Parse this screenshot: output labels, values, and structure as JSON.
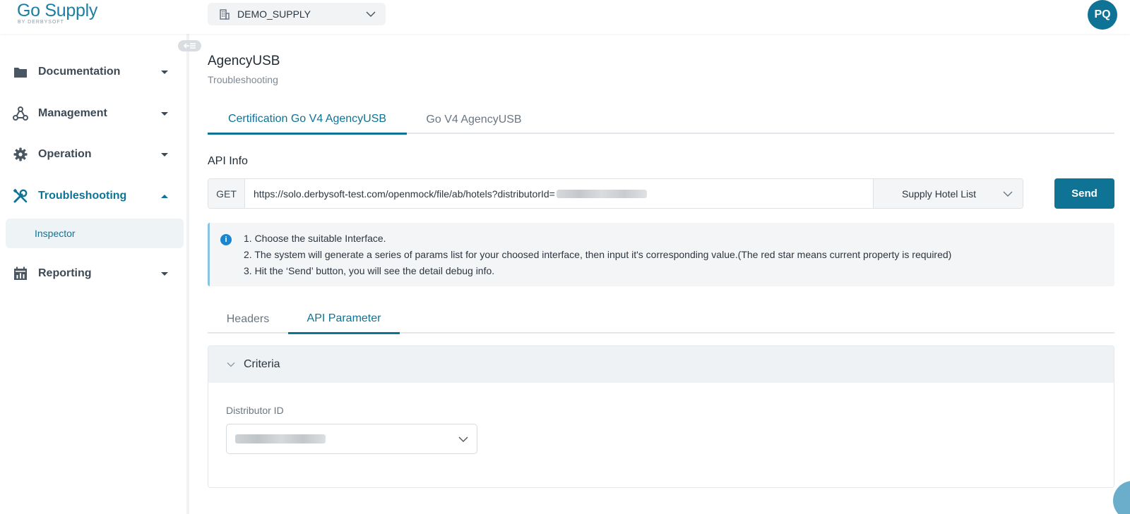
{
  "brand": {
    "name": "Go Supply",
    "tagline": "BY DERBYSOFT"
  },
  "tenant": {
    "name": "DEMO_SUPPLY"
  },
  "user": {
    "initials": "PQ"
  },
  "sidebar": {
    "items": [
      {
        "label": "Documentation",
        "icon": "folder-icon",
        "expanded": false
      },
      {
        "label": "Management",
        "icon": "network-icon",
        "expanded": false
      },
      {
        "label": "Operation",
        "icon": "gear-icon",
        "expanded": false
      },
      {
        "label": "Troubleshooting",
        "icon": "tools-icon",
        "expanded": true,
        "children": [
          {
            "label": "Inspector",
            "active": true
          }
        ]
      },
      {
        "label": "Reporting",
        "icon": "report-icon",
        "expanded": false
      }
    ]
  },
  "page": {
    "title": "AgencyUSB",
    "subtitle": "Troubleshooting",
    "tabs": [
      {
        "label": "Certification Go V4 AgencyUSB",
        "active": true
      },
      {
        "label": "Go V4 AgencyUSB",
        "active": false
      }
    ]
  },
  "api": {
    "label": "API Info",
    "method": "GET",
    "url": "https://solo.derbysoft-test.com/openmock/file/ab/hotels?distributorId=",
    "interface": "Supply Hotel List",
    "send_label": "Send"
  },
  "info": {
    "lines": [
      "1. Choose the suitable Interface.",
      "2. The system will generate a series of params list for your choosed interface, then input it's corresponding value.(The red star means current property is required)",
      "3. Hit the ‘Send’ button, you will see the detail debug info."
    ]
  },
  "param_tabs": [
    {
      "label": "Headers",
      "active": false
    },
    {
      "label": "API Parameter",
      "active": true
    }
  ],
  "criteria": {
    "title": "Criteria",
    "field_label": "Distributor ID"
  },
  "colors": {
    "accent": "#0f7395",
    "info": "#1a85d1"
  }
}
